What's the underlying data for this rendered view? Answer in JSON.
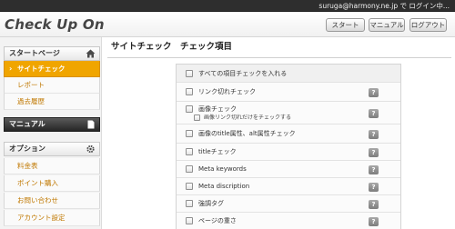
{
  "topbar": {
    "user_status": "suruga@harmony.ne.jp で ログイン中..."
  },
  "header": {
    "logo": "Check Up On",
    "buttons": {
      "start": "スタート",
      "manual": "マニュアル",
      "logout": "ログアウト"
    }
  },
  "sidebar": {
    "start_section": {
      "title": "スタートページ",
      "icon": "home-icon",
      "items": [
        {
          "label": "サイトチェック",
          "active": true
        },
        {
          "label": "レポート"
        },
        {
          "label": "過去履歴"
        }
      ]
    },
    "manual_section": {
      "title": "マニュアル",
      "icon": "document-icon"
    },
    "options_section": {
      "title": "オプション",
      "icon": "gear-icon",
      "items": [
        {
          "label": "料金表"
        },
        {
          "label": "ポイント購入"
        },
        {
          "label": "お問い合わせ"
        },
        {
          "label": "アカウント設定"
        }
      ]
    }
  },
  "main": {
    "title": "サイトチェック　チェック項目",
    "check_all_label": "すべての項目チェックを入れる",
    "help_label": "?",
    "checks": [
      {
        "label": "リンク切れチェック"
      },
      {
        "label": "画像チェック",
        "sublabel": "画像リンク切れだけをチェックする"
      },
      {
        "label": "画像のtitle属性、alt属性チェック"
      },
      {
        "label": "titleチェック"
      },
      {
        "label": "Meta keywords"
      },
      {
        "label": "Meta discription"
      },
      {
        "label": "強調タグ"
      },
      {
        "label": "ページの重さ"
      }
    ]
  },
  "colors": {
    "accent": "#f0a500",
    "link": "#c07800",
    "dark_header": "#262626"
  }
}
